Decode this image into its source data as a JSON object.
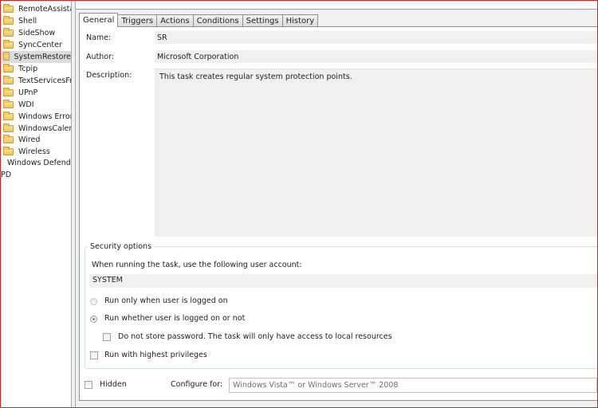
{
  "tree": {
    "folders": [
      {
        "label": "RemoteAssista",
        "selected": false
      },
      {
        "label": "Shell",
        "selected": false
      },
      {
        "label": "SideShow",
        "selected": false
      },
      {
        "label": "SyncCenter",
        "selected": false
      },
      {
        "label": "SystemRestore",
        "selected": true
      },
      {
        "label": "Tcpip",
        "selected": false
      },
      {
        "label": "TextServicesFra",
        "selected": false
      },
      {
        "label": "UPnP",
        "selected": false
      },
      {
        "label": "WDI",
        "selected": false
      },
      {
        "label": "Windows Error",
        "selected": false
      },
      {
        "label": "WindowsCaler",
        "selected": false
      },
      {
        "label": "Wired",
        "selected": false
      },
      {
        "label": "Wireless",
        "selected": false
      }
    ],
    "defender_label": "Windows Defende",
    "pd_label": "PD"
  },
  "tabs": [
    "General",
    "Triggers",
    "Actions",
    "Conditions",
    "Settings",
    "History"
  ],
  "general": {
    "name_label": "Name:",
    "name_value": "SR",
    "author_label": "Author:",
    "author_value": "Microsoft Corporation",
    "description_label": "Description:",
    "description_value": "This task creates regular system protection points."
  },
  "security": {
    "title": "Security options",
    "account_prompt": "When running the task, use the following user account:",
    "account_value": "SYSTEM",
    "radio_logged_on": "Run only when user is logged on",
    "radio_whether": "Run whether user is logged on or not",
    "checkbox_no_store": "Do not store password.  The task will only have access to local resources",
    "checkbox_highest": "Run with highest privileges"
  },
  "bottom": {
    "hidden_label": "Hidden",
    "configure_label": "Configure for:",
    "configure_value": "Windows Vista™ or Windows Server™ 2008"
  }
}
